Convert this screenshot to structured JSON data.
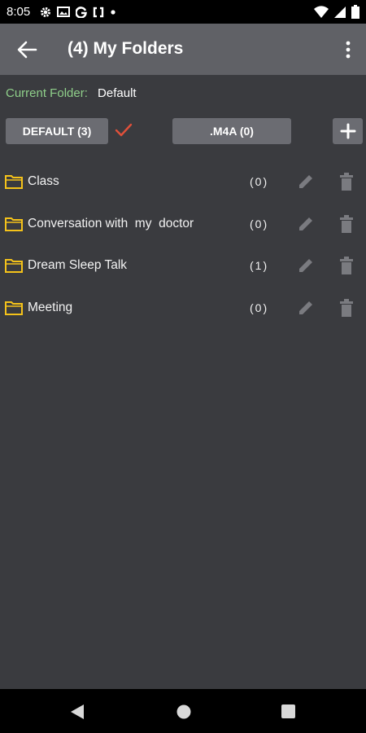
{
  "status_bar": {
    "time": "8:05",
    "left_icons": [
      "gear-icon",
      "image-icon",
      "g-icon",
      "sync-icon",
      "dot-icon"
    ],
    "right_icons": [
      "wifi-icon",
      "signal-icon",
      "battery-icon"
    ]
  },
  "app_bar": {
    "title": "(4) My Folders",
    "back_icon": "arrow-left-icon",
    "menu_icon": "more-vert-icon"
  },
  "current_folder": {
    "label": "Current Folder:",
    "value": "Default"
  },
  "filters": {
    "default_button": "DEFAULT (3)",
    "m4a_button": ".M4A (0)",
    "add_button": "+",
    "selected_icon": "check-icon"
  },
  "folders": [
    {
      "name": "Class",
      "count": "(0)"
    },
    {
      "name": "Conversation with  my  doctor",
      "count": "(0)"
    },
    {
      "name": "Dream Sleep Talk",
      "count": "(1)"
    },
    {
      "name": "Meeting",
      "count": "(0)"
    }
  ],
  "colors": {
    "background": "#3a3b3f",
    "app_bar": "#606166",
    "current_label": "#8fcf8a",
    "check": "#e0503a",
    "folder_icon": "#f4c21a",
    "action_icon": "#7a7b80"
  },
  "nav_bar": {
    "icons": [
      "nav-back-icon",
      "nav-home-icon",
      "nav-recents-icon"
    ]
  }
}
